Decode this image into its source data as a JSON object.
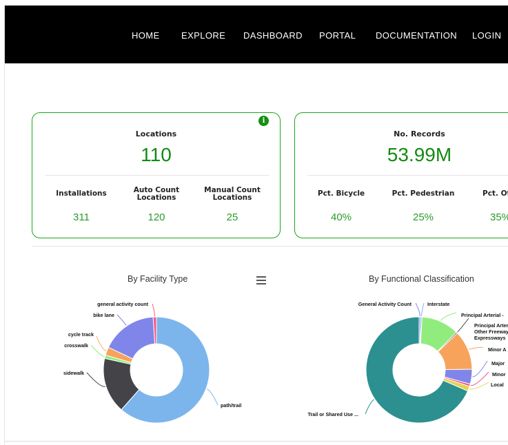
{
  "nav": {
    "items": [
      {
        "key": "home",
        "label": "HOME"
      },
      {
        "key": "explore",
        "label": "EXPLORE"
      },
      {
        "key": "dashboard",
        "label": "DASHBOARD"
      },
      {
        "key": "portal",
        "label": "PORTAL"
      },
      {
        "key": "documentation",
        "label": "DOCUMENTATION"
      },
      {
        "key": "login",
        "label": "LOGIN"
      }
    ]
  },
  "cards": {
    "locations": {
      "title": "Locations",
      "value": "110",
      "info_icon": "info-icon",
      "stats": [
        {
          "label": "Installations",
          "value": "311"
        },
        {
          "label": "Auto Count Locations",
          "value": "120"
        },
        {
          "label": "Manual Count Locations",
          "value": "25"
        }
      ]
    },
    "records": {
      "title": "No. Records",
      "value": "53.99M",
      "stats": [
        {
          "label": "Pct. Bicycle",
          "value": "40%"
        },
        {
          "label": "Pct. Pedestrian",
          "value": "25%"
        },
        {
          "label": "Pct. Oth",
          "value": "35%"
        }
      ]
    }
  },
  "colors": {
    "accent_green": "#138a13",
    "card_border": "#1aa51a",
    "navbar": "#000000"
  },
  "chart_data": [
    {
      "type": "pie",
      "title": "By Facility Type",
      "donut": true,
      "menu_icon": "hamburger-menu-icon",
      "slices": [
        {
          "label": "path/trail",
          "value": 61.5,
          "color": "#7cb5ec"
        },
        {
          "label": "sidewalk",
          "value": 17.0,
          "color": "#434348"
        },
        {
          "label": "crosswalk",
          "value": 1.0,
          "color": "#90ed7d"
        },
        {
          "label": "cycle track",
          "value": 2.5,
          "color": "#f7a35c"
        },
        {
          "label": "bike lane",
          "value": 17.0,
          "color": "#8085e9"
        },
        {
          "label": "general activity count",
          "value": 1.0,
          "color": "#f15c80"
        }
      ]
    },
    {
      "type": "pie",
      "title": "By Functional Classification",
      "donut": true,
      "slices": [
        {
          "label": "Trail or Shared Use ...",
          "value": 68.5,
          "color": "#2b908f"
        },
        {
          "label": "Local",
          "value": 1.5,
          "color": "#e4d354"
        },
        {
          "label": "Minor",
          "value": 0.7,
          "color": "#f15c80"
        },
        {
          "label": "Major",
          "value": 4.5,
          "color": "#8085e9"
        },
        {
          "label": "Minor A",
          "value": 12.0,
          "color": "#f7a35c"
        },
        {
          "label": "Principal Arterial - Other Freeways Expressways",
          "value": 0.4,
          "color": "#434348"
        },
        {
          "label": "Principal Arterial -",
          "value": 11.5,
          "color": "#90ed7d"
        },
        {
          "label": "Interstate",
          "value": 0.4,
          "color": "#7cb5ec"
        },
        {
          "label": "General Activity Count",
          "value": 0.5,
          "color": "#8085e9"
        }
      ]
    }
  ]
}
